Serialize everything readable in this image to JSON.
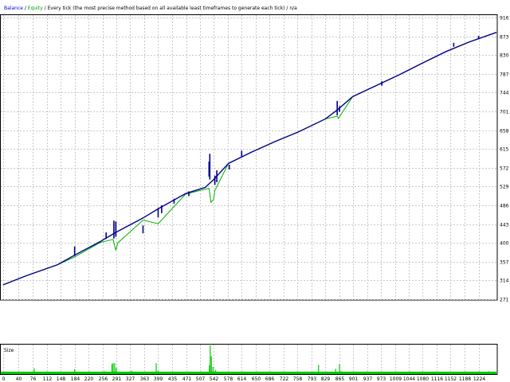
{
  "header": {
    "balance_label": "Balance",
    "sep1": " / ",
    "equity_label": "Equity",
    "sep2": " / ",
    "description": "Every tick (the most precise method based on all available least timeframes to generate each tick)",
    "sep3": " / ",
    "na": "n/a"
  },
  "colors": {
    "balance": "#00008B",
    "equity": "#00B000",
    "volume": "#00CC00",
    "grid": "#C8C8C8",
    "axis": "#000000",
    "header_balance": "#0000CD",
    "header_equity": "#00A000",
    "background": "#FFFFFF"
  },
  "chart_data": [
    {
      "type": "line",
      "title": "",
      "xlabel": "",
      "ylabel": "",
      "ylim": [
        271,
        916
      ],
      "xlim": [
        0,
        1270
      ],
      "grid": true,
      "y_ticks": [
        "916",
        "873",
        "830",
        "787",
        "744",
        "701",
        "658",
        "615",
        "572",
        "529",
        "486",
        "443",
        "400",
        "357",
        "314",
        "271"
      ],
      "series": [
        {
          "name": "Balance",
          "color": "#00008B",
          "x": [
            0,
            60,
            140,
            184,
            250,
            290,
            360,
            399,
            470,
            520,
            542,
            580,
            640,
            700,
            760,
            830,
            861,
            900,
            960,
            1020,
            1080,
            1140,
            1200,
            1270
          ],
          "y": [
            304,
            325,
            350,
            372,
            403,
            424,
            457,
            478,
            513,
            527,
            545,
            582,
            608,
            632,
            654,
            684,
            705,
            735,
            760,
            785,
            812,
            838,
            860,
            882
          ]
        },
        {
          "name": "Equity",
          "color": "#00B000",
          "x": [
            0,
            60,
            140,
            184,
            250,
            283,
            290,
            295,
            360,
            399,
            470,
            530,
            535,
            542,
            545,
            580,
            640,
            700,
            760,
            830,
            860,
            863,
            900,
            960,
            1020,
            1080,
            1140,
            1200,
            1270
          ],
          "y": [
            304,
            325,
            350,
            368,
            401,
            408,
            383,
            400,
            452,
            444,
            512,
            525,
            493,
            500,
            520,
            582,
            608,
            632,
            654,
            684,
            690,
            685,
            735,
            760,
            785,
            812,
            838,
            860,
            882
          ]
        }
      ],
      "spikes": [
        {
          "x": 184,
          "min": 370,
          "max": 392
        },
        {
          "x": 265,
          "min": 409,
          "max": 424
        },
        {
          "x": 285,
          "min": 410,
          "max": 451
        },
        {
          "x": 290,
          "min": 414,
          "max": 449
        },
        {
          "x": 360,
          "min": 422,
          "max": 440
        },
        {
          "x": 399,
          "min": 458,
          "max": 480
        },
        {
          "x": 408,
          "min": 468,
          "max": 486
        },
        {
          "x": 440,
          "min": 490,
          "max": 501
        },
        {
          "x": 478,
          "min": 507,
          "max": 518
        },
        {
          "x": 530,
          "min": 552,
          "max": 586
        },
        {
          "x": 532,
          "min": 545,
          "max": 604
        },
        {
          "x": 545,
          "min": 533,
          "max": 554
        },
        {
          "x": 550,
          "min": 539,
          "max": 566
        },
        {
          "x": 582,
          "min": 568,
          "max": 579
        },
        {
          "x": 614,
          "min": 597,
          "max": 611
        },
        {
          "x": 860,
          "min": 692,
          "max": 725
        },
        {
          "x": 866,
          "min": 700,
          "max": 713
        },
        {
          "x": 975,
          "min": 760,
          "max": 770
        },
        {
          "x": 1160,
          "min": 849,
          "max": 858
        },
        {
          "x": 1224,
          "min": 866,
          "max": 874
        }
      ]
    },
    {
      "type": "bar",
      "title": "Size",
      "ylim": [
        0,
        1
      ],
      "bars": [
        {
          "x": 80,
          "v": 0.2
        },
        {
          "x": 184,
          "v": 0.17
        },
        {
          "x": 262,
          "v": 0.1
        },
        {
          "x": 280,
          "v": 0.35
        },
        {
          "x": 283,
          "v": 0.38
        },
        {
          "x": 287,
          "v": 0.38
        },
        {
          "x": 291,
          "v": 0.22
        },
        {
          "x": 300,
          "v": 0.08
        },
        {
          "x": 331,
          "v": 0.12
        },
        {
          "x": 360,
          "v": 0.06
        },
        {
          "x": 394,
          "v": 0.38
        },
        {
          "x": 399,
          "v": 0.12
        },
        {
          "x": 440,
          "v": 0.07
        },
        {
          "x": 531,
          "v": 0.3
        },
        {
          "x": 533,
          "v": 1.0
        },
        {
          "x": 536,
          "v": 0.62
        },
        {
          "x": 540,
          "v": 0.25
        },
        {
          "x": 547,
          "v": 0.14
        },
        {
          "x": 558,
          "v": 0.06
        },
        {
          "x": 614,
          "v": 0.08
        },
        {
          "x": 660,
          "v": 0.06
        },
        {
          "x": 812,
          "v": 0.32
        },
        {
          "x": 856,
          "v": 0.18
        },
        {
          "x": 866,
          "v": 0.35
        },
        {
          "x": 870,
          "v": 0.1
        },
        {
          "x": 935,
          "v": 0.07
        },
        {
          "x": 1000,
          "v": 0.06
        },
        {
          "x": 1100,
          "v": 0.05
        },
        {
          "x": 1160,
          "v": 0.06
        },
        {
          "x": 1250,
          "v": 0.1
        }
      ],
      "x_ticks": [
        "0",
        "40",
        "76",
        "112",
        "148",
        "184",
        "220",
        "256",
        "291",
        "327",
        "363",
        "399",
        "435",
        "471",
        "507",
        "542",
        "578",
        "614",
        "650",
        "686",
        "722",
        "758",
        "793",
        "829",
        "865",
        "901",
        "937",
        "973",
        "1009",
        "1044",
        "1080",
        "1116",
        "1152",
        "1188",
        "1224"
      ]
    }
  ]
}
